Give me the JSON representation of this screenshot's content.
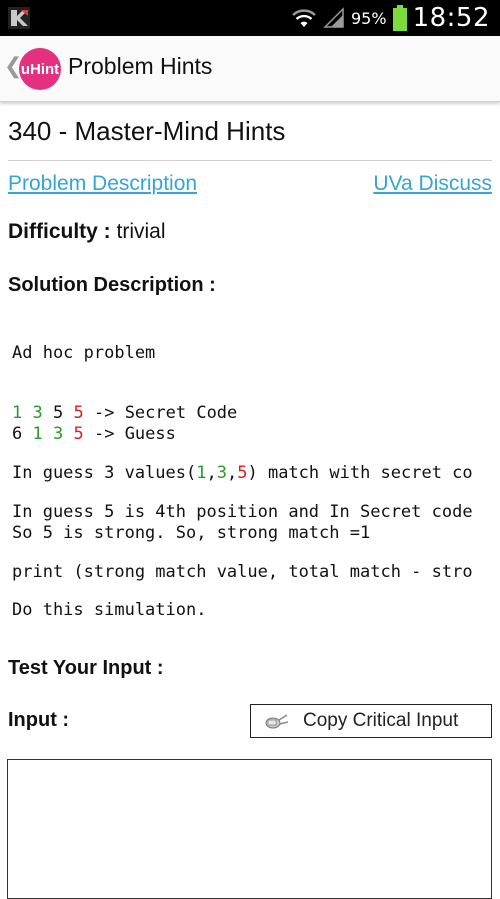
{
  "status_bar": {
    "battery_percent": "95%",
    "time": "18:52",
    "icons": [
      "app-notification-icon",
      "wifi-icon",
      "signal-icon",
      "battery-icon"
    ]
  },
  "action_bar": {
    "back_glyph": "❮",
    "logo_text": "uHint",
    "title": "Problem Hints"
  },
  "problem": {
    "title": "340 - Master-Mind Hints",
    "links": {
      "description": "Problem Description",
      "discuss": "UVa Discuss"
    },
    "difficulty_label": "Difficulty :",
    "difficulty_value": " trivial"
  },
  "solution": {
    "heading": "Solution Description :",
    "line1": "Ad hoc problem",
    "secret_line": {
      "tokens": [
        "1",
        "3",
        "5",
        "5"
      ],
      "suffix": " -> Secret Code"
    },
    "guess_line": {
      "tokens": [
        "6",
        "1",
        "3",
        "5"
      ],
      "suffix": " -> Guess"
    },
    "guess3": {
      "prefix": "In guess 3 values(",
      "v1": "1",
      "v2": "3",
      "v3": "5",
      "suffix": ") match with secret co"
    },
    "strong_line1": "In guess 5 is 4th position and In Secret code",
    "strong_line2": "So 5 is strong. So, strong match =1",
    "print_line": "print (strong match value, total match - stro",
    "sim_line": "Do this simulation."
  },
  "test": {
    "heading": "Test Your Input :",
    "input_label": "Input :",
    "copy_button": "Copy Critical Input",
    "input_value": ""
  },
  "colors": {
    "link": "#35a5d6",
    "logo": "#e3317f",
    "match_green": "#2a9a2a",
    "mismatch_red": "#d62020"
  }
}
